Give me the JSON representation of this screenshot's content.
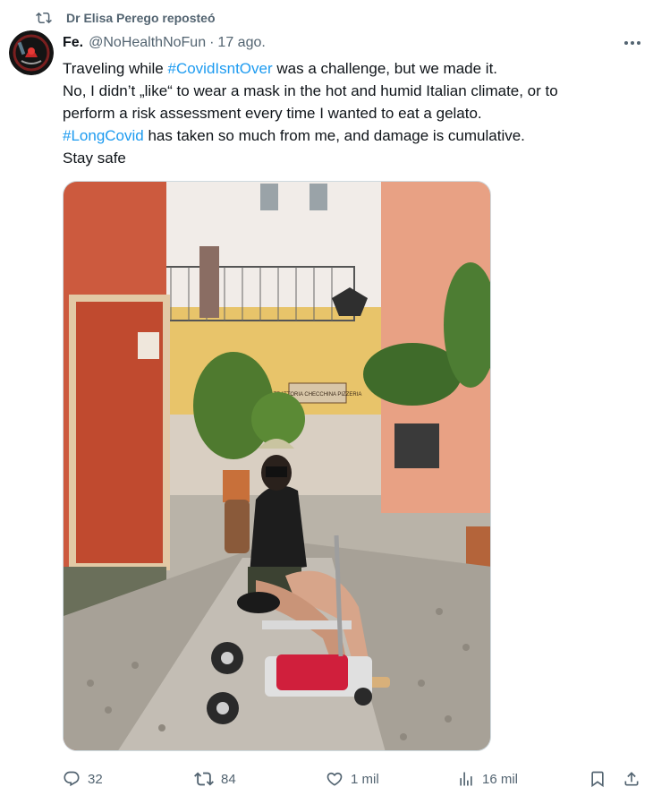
{
  "repost": {
    "text": "Dr Elisa Perego reposteó",
    "icon": "repost-icon"
  },
  "author": {
    "name": "Fe.",
    "handle": "@NoHealthNoFun",
    "separator": "·",
    "date": "17 ago."
  },
  "tweet": {
    "line1_prefix": "Traveling while ",
    "line1_hashtag": "#CovidIsntOver",
    "line1_suffix": " was a challenge, but we made it.",
    "line2": "No, I didn’t „like“ to wear a mask in the hot and humid Italian climate, or to",
    "line3": "perform a risk assessment every time I wanted to eat a gelato.",
    "line4_hashtag": "#LongCovid",
    "line4_suffix": " has taken so much from me, and damage is cumulative.",
    "line5": "Stay safe"
  },
  "photo": {
    "sign_text": "TRATTORIA CHECCHINA PIZZERIA"
  },
  "actions": {
    "replies": "32",
    "reposts": "84",
    "likes": "1 mil",
    "views": "16 mil"
  },
  "colors": {
    "accent": "#1d9bf0",
    "muted": "#536471",
    "text": "#0f1419"
  }
}
